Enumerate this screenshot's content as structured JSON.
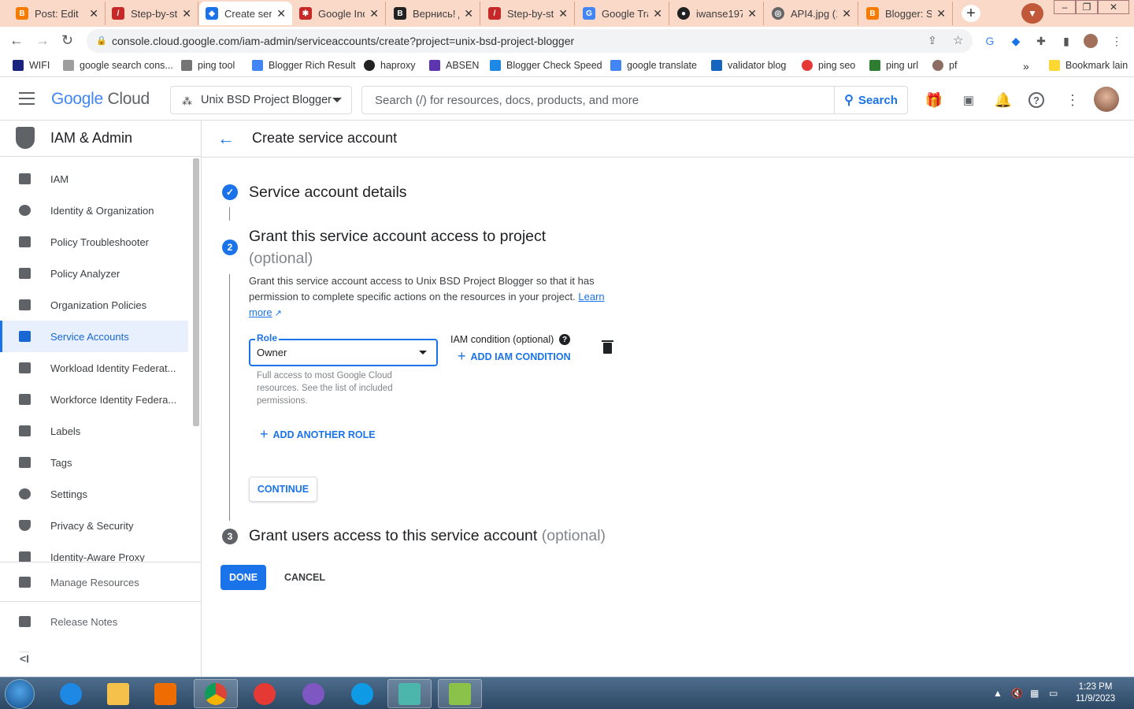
{
  "browser": {
    "tabs": [
      {
        "title": "Post: Edit",
        "icon": "blogger-icon",
        "color": "#f57c00"
      },
      {
        "title": "Step-by-st",
        "icon": "app-icon",
        "color": "#c62828"
      },
      {
        "title": "Create ser",
        "icon": "google-cloud-icon",
        "color": "#1a73e8"
      },
      {
        "title": "Google Ind",
        "icon": "search-console-icon",
        "color": "#c62828"
      },
      {
        "title": "Вернись! Д",
        "icon": "b-icon",
        "color": "#222222"
      },
      {
        "title": "Step-by-st",
        "icon": "app-icon",
        "color": "#c62828"
      },
      {
        "title": "Google Tra",
        "icon": "translate-icon",
        "color": "#4285f4"
      },
      {
        "title": "iwanse197",
        "icon": "github-icon",
        "color": "#222222"
      },
      {
        "title": "API4.jpg (1",
        "icon": "globe-icon",
        "color": "#666666"
      },
      {
        "title": "Blogger: S",
        "icon": "blogger-icon",
        "color": "#f57c00"
      }
    ],
    "url": "console.cloud.google.com/iam-admin/serviceaccounts/create?project=unix-bsd-project-blogger",
    "bookmarks": [
      {
        "label": "WIFI",
        "color": "#1a237e"
      },
      {
        "label": "google search cons...",
        "color": "#9e9e9e"
      },
      {
        "label": "ping tool",
        "color": "#757575"
      },
      {
        "label": "Blogger Rich Result",
        "color": "#4285f4"
      },
      {
        "label": "haproxy",
        "color": "#222222"
      },
      {
        "label": "ABSEN",
        "color": "#5e35b1"
      },
      {
        "label": "Blogger Check Speed",
        "color": "#1e88e5"
      },
      {
        "label": "google translate",
        "color": "#4285f4"
      },
      {
        "label": "validator blog",
        "color": "#1565c0"
      },
      {
        "label": "ping seo",
        "color": "#e53935"
      },
      {
        "label": "ping url",
        "color": "#2e7d32"
      },
      {
        "label": "pf",
        "color": "#8d6e63"
      },
      {
        "label": "Bookmark lain",
        "color": "#fdd835"
      }
    ],
    "more_bookmarks": "»"
  },
  "gcp": {
    "logo_google": "Google",
    "logo_cloud": "Cloud",
    "project": "Unix BSD Project Blogger",
    "search_placeholder": "Search (/) for resources, docs, products, and more",
    "search_button": "Search"
  },
  "sidebar": {
    "title": "IAM & Admin",
    "items": [
      {
        "label": "IAM",
        "icon": "person-add-icon"
      },
      {
        "label": "Identity & Organization",
        "icon": "account-circle-icon"
      },
      {
        "label": "Policy Troubleshooter",
        "icon": "wrench-icon"
      },
      {
        "label": "Policy Analyzer",
        "icon": "policy-analyzer-icon"
      },
      {
        "label": "Organization Policies",
        "icon": "list-doc-icon"
      },
      {
        "label": "Service Accounts",
        "icon": "service-account-icon"
      },
      {
        "label": "Workload Identity Federat...",
        "icon": "id-card-icon"
      },
      {
        "label": "Workforce Identity Federa...",
        "icon": "list-icon"
      },
      {
        "label": "Labels",
        "icon": "label-icon"
      },
      {
        "label": "Tags",
        "icon": "tag-icon"
      },
      {
        "label": "Settings",
        "icon": "gear-icon"
      },
      {
        "label": "Privacy & Security",
        "icon": "shield-icon"
      },
      {
        "label": "Identity-Aware Proxy",
        "icon": "proxy-icon"
      }
    ],
    "selected": "Service Accounts",
    "footer": [
      {
        "label": "Manage Resources",
        "icon": "manage-resources-icon"
      },
      {
        "label": "Release Notes",
        "icon": "release-notes-icon"
      }
    ],
    "collapse_glyph": "<I"
  },
  "page": {
    "title": "Create service account",
    "step1": {
      "title": "Service account details"
    },
    "step2": {
      "number": "2",
      "title": "Grant this service account access to project",
      "optional": "(optional)",
      "description": "Grant this service account access to Unix BSD Project Blogger so that it has permission to complete specific actions on the resources in your project.",
      "learn_more": "Learn more",
      "role_label": "Role",
      "role_value": "Owner",
      "role_help": "Full access to most Google Cloud resources. See the list of included permissions.",
      "iam_condition_label": "IAM condition (optional)",
      "add_condition": "ADD IAM CONDITION",
      "add_role": "ADD ANOTHER ROLE",
      "continue": "CONTINUE"
    },
    "step3": {
      "number": "3",
      "title": "Grant users access to this service account",
      "optional": "(optional)"
    },
    "done": "DONE",
    "cancel": "CANCEL"
  },
  "taskbar": {
    "time": "1:23 PM",
    "date": "11/9/2023"
  },
  "colors": {
    "accent": "#1a73e8",
    "selected_bg": "#e8f0fe",
    "tabstrip": "#fbd9c9"
  }
}
